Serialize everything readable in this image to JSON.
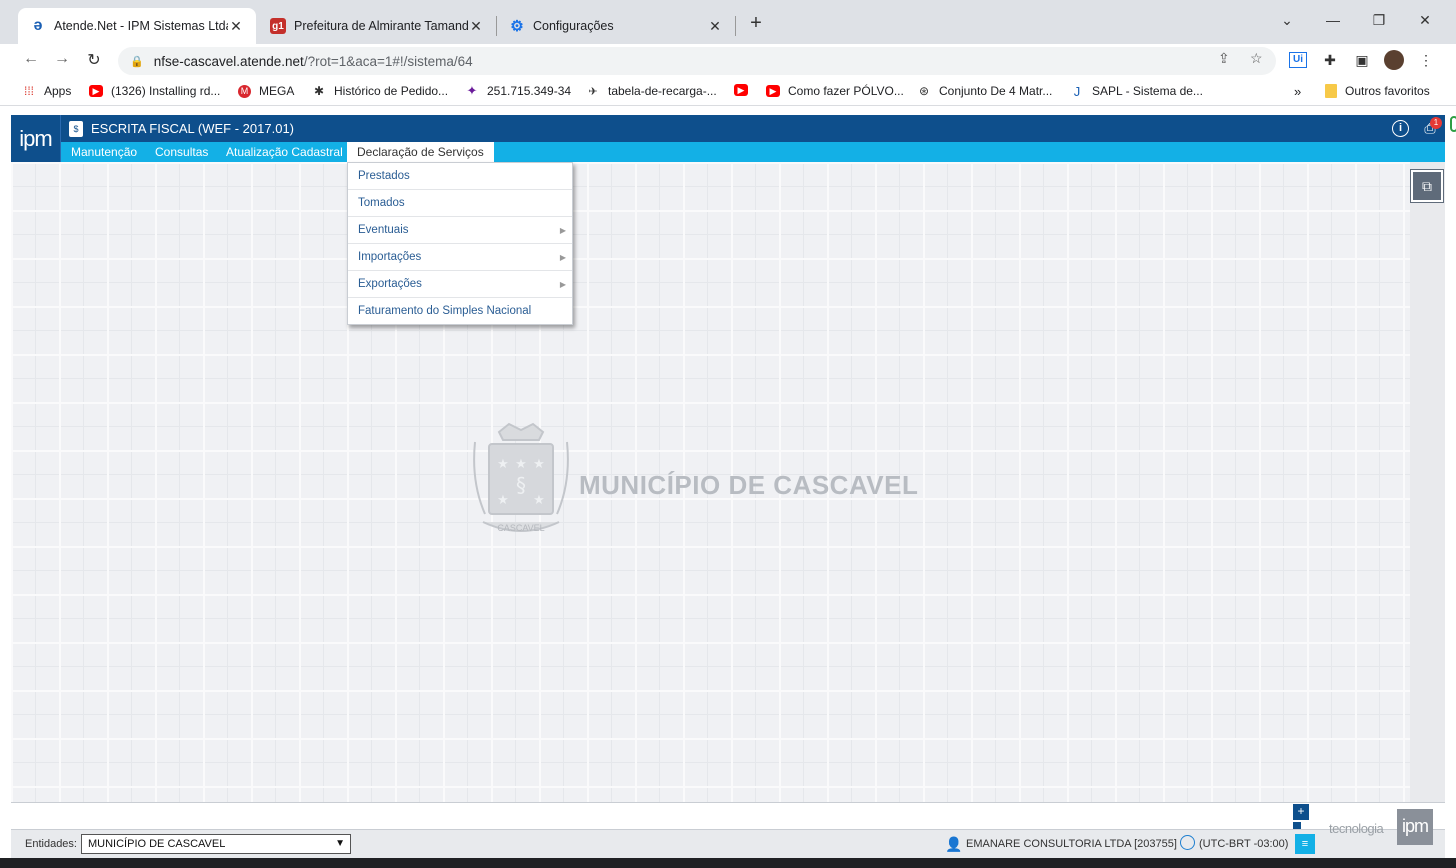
{
  "browser": {
    "tabs": [
      {
        "title": "Atende.Net - IPM Sistemas Ltda",
        "icon": "atende-icon",
        "active": true
      },
      {
        "title": "Prefeitura de Almirante Tamanda",
        "icon": "g1-icon",
        "active": false
      },
      {
        "title": "Configurações",
        "icon": "gear-icon",
        "active": false
      }
    ],
    "url_host": "nfse-cascavel.atende.net",
    "url_path": "/?rot=1&aca=1#!/sistema/64",
    "bookmarks": [
      "Apps",
      "(1326) Installing rd...",
      "MEGA",
      "Histórico de Pedido...",
      "251.715.349-34",
      "tabela-de-recarga-...",
      "",
      "Como fazer PÓLVO...",
      "Conjunto De 4 Matr...",
      "SAPL - Sistema de..."
    ],
    "other_bookmarks": "Outros favoritos",
    "more_bookmarks": "»",
    "g1_icon_text": "g1",
    "extension_text": "Ui"
  },
  "app": {
    "logo": "ipm",
    "system_title": "ESCRITA FISCAL (WEF - 2017.01)",
    "notification_count": "1",
    "menu": [
      "Manutenção",
      "Consultas",
      "Atualização Cadastral",
      "Declaração de Serviços"
    ],
    "open_menu": "Declaração de Serviços",
    "dropdown": [
      {
        "label": "Prestados",
        "submenu": false
      },
      {
        "label": "Tomados",
        "submenu": false
      },
      {
        "label": "Eventuais",
        "submenu": true
      },
      {
        "label": "Importações",
        "submenu": true
      },
      {
        "label": "Exportações",
        "submenu": true
      },
      {
        "label": "Faturamento do Simples Nacional",
        "submenu": false
      }
    ],
    "municipality": "MUNICÍPIO DE CASCAVEL",
    "emblem_text": "CASCAVEL",
    "footer": {
      "entities_label": "Entidades:",
      "entity_selected": "MUNICÍPIO DE CASCAVEL",
      "user": "EMANARE CONSULTORIA LTDA [203755]",
      "timezone": "(UTC-BRT -03:00)",
      "brand_text": "tecnologia",
      "brand_logo": "ipm"
    }
  },
  "colors": {
    "header_blue": "#0e4f8c",
    "menu_cyan": "#13b0e6",
    "link_blue": "#2a5d94"
  }
}
